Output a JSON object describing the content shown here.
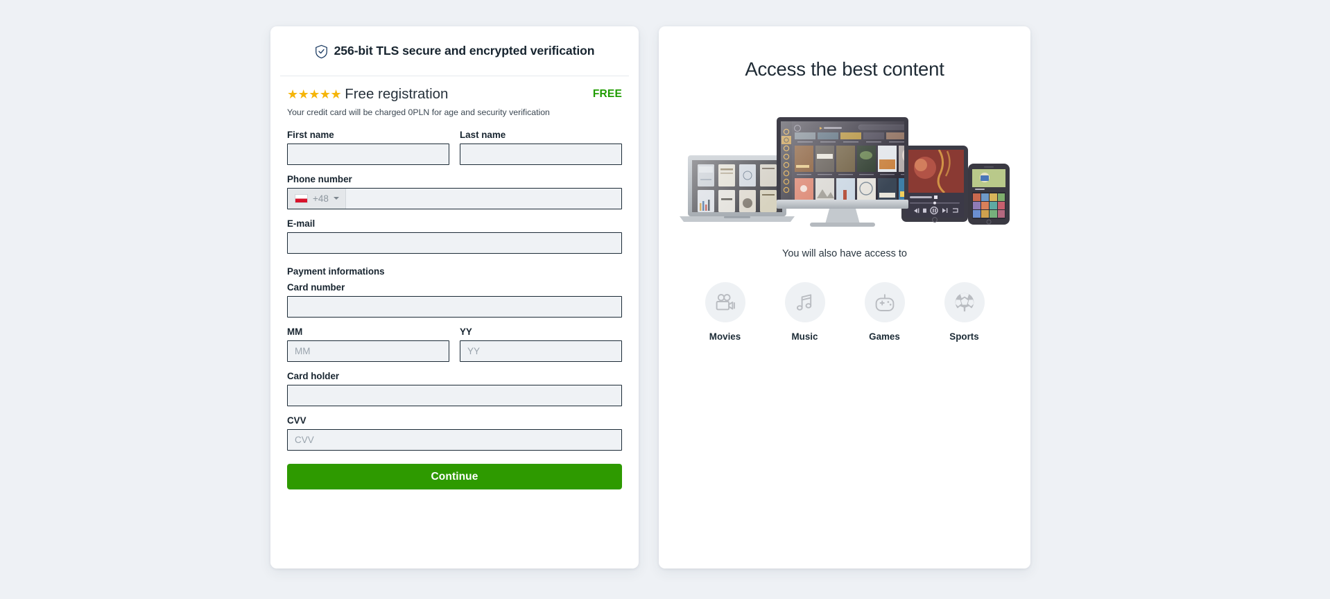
{
  "left_panel": {
    "secure_header": "256-bit TLS secure and encrypted verification",
    "shield_icon": "shield-check-icon",
    "plan": {
      "stars": "★★★★★",
      "star_count": 5,
      "title": "Free registration",
      "badge": "FREE",
      "note": "Your credit card will be charged 0PLN for age and security verification"
    },
    "fields": {
      "first_name": {
        "label": "First name",
        "value": "",
        "placeholder": ""
      },
      "last_name": {
        "label": "Last name",
        "value": "",
        "placeholder": ""
      },
      "phone": {
        "label": "Phone number",
        "value": "",
        "placeholder": "",
        "country_flag": "pl",
        "dial_code": "+48"
      },
      "email": {
        "label": "E-mail",
        "value": "",
        "placeholder": ""
      },
      "payment_section": "Payment informations",
      "card_number": {
        "label": "Card number",
        "value": "",
        "placeholder": ""
      },
      "expiry_month": {
        "label": "MM",
        "value": "",
        "placeholder": "MM"
      },
      "expiry_year": {
        "label": "YY",
        "value": "",
        "placeholder": "YY"
      },
      "card_holder": {
        "label": "Card holder",
        "value": "",
        "placeholder": ""
      },
      "cvv": {
        "label": "CVV",
        "value": "",
        "placeholder": "CVV"
      }
    },
    "submit_label": "Continue"
  },
  "right_panel": {
    "title": "Access the best content",
    "devices_image": "multi-device-mockup",
    "subtitle": "You will also have access to",
    "features": [
      {
        "label": "Movies",
        "icon": "film-camera-icon"
      },
      {
        "label": "Music",
        "icon": "music-note-icon"
      },
      {
        "label": "Games",
        "icon": "gamepad-icon"
      },
      {
        "label": "Sports",
        "icon": "soccer-ball-icon"
      }
    ]
  },
  "colors": {
    "page_background": "#eef1f5",
    "card_background": "#ffffff",
    "accent_green": "#2e9a00",
    "badge_green": "#1f9c00",
    "star_gold": "#f5b50a",
    "input_background": "#eff2f5",
    "input_border": "#1b2a36",
    "text_dark": "#17242f",
    "flag_red": "#d8132b"
  }
}
